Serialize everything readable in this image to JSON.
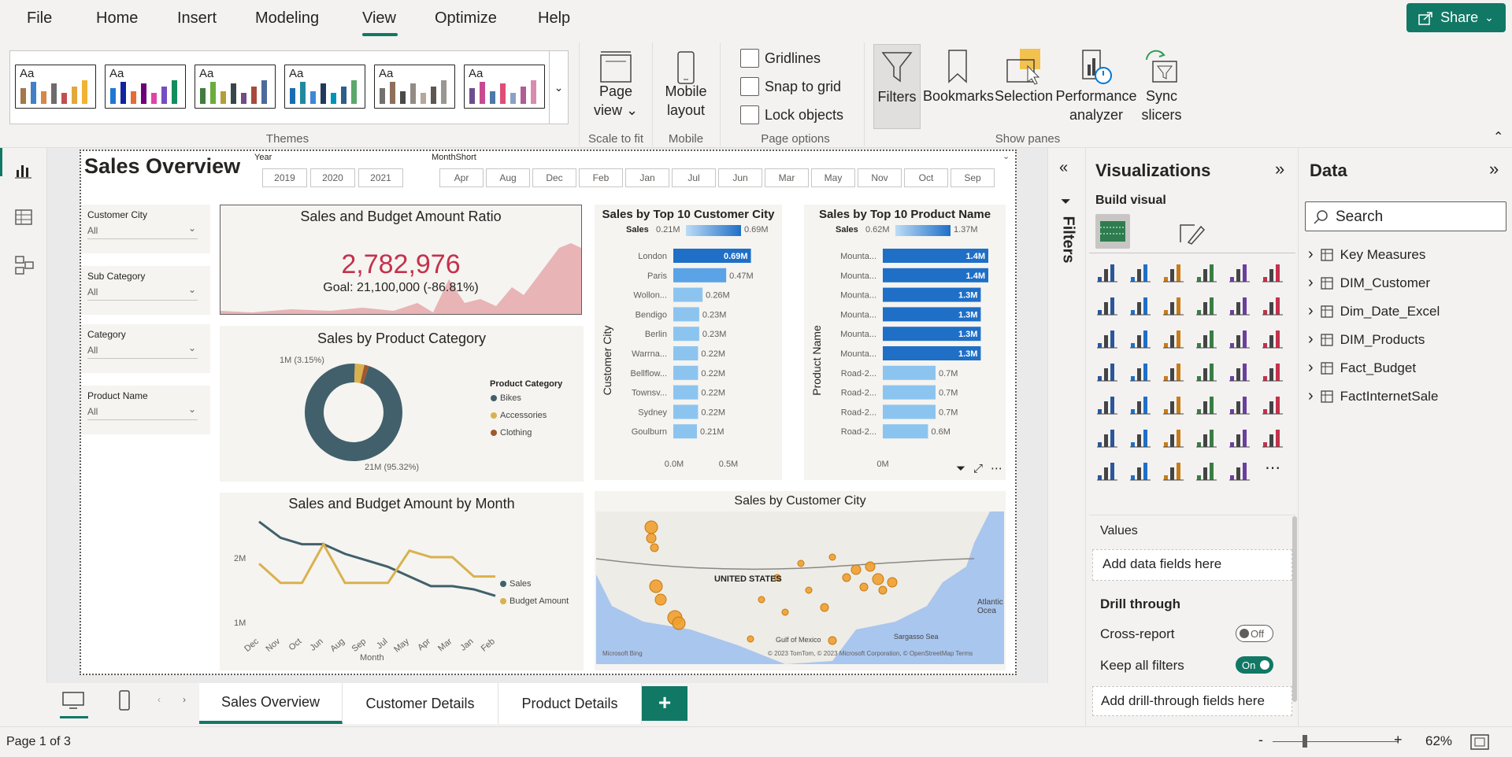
{
  "menu": {
    "file": "File",
    "home": "Home",
    "insert": "Insert",
    "modeling": "Modeling",
    "view": "View",
    "optimize": "Optimize",
    "help": "Help",
    "share": "Share"
  },
  "ribbon": {
    "themes_label": "Themes",
    "theme_aa": "Aa",
    "page_view": "Page view",
    "scale_to_fit": "Scale to fit",
    "mobile_layout": "Mobile layout",
    "mobile_label": "Mobile",
    "gridlines": "Gridlines",
    "snap_to_grid": "Snap to grid",
    "lock_objects": "Lock objects",
    "page_options": "Page options",
    "filters": "Filters",
    "bookmarks": "Bookmarks",
    "selection": "Selection",
    "performance_analyzer": "Performance analyzer",
    "sync_slicers": "Sync slicers",
    "show_panes": "Show panes"
  },
  "report": {
    "title": "Sales Overview",
    "year_label": "Year",
    "years": [
      "2019",
      "2020",
      "2021"
    ],
    "month_label": "MonthShort",
    "months": [
      "Apr",
      "Aug",
      "Dec",
      "Feb",
      "Jan",
      "Jul",
      "Jun",
      "Mar",
      "May",
      "Nov",
      "Oct",
      "Sep"
    ],
    "slicers": [
      {
        "label": "Customer City",
        "value": "All"
      },
      {
        "label": "Sub Category",
        "value": "All"
      },
      {
        "label": "Category",
        "value": "All"
      },
      {
        "label": "Product Name",
        "value": "All"
      }
    ],
    "kpi": {
      "title": "Sales and Budget Amount Ratio",
      "value": "2,782,976",
      "goal": "Goal: 21,100,000 (-86.81%)"
    },
    "donut": {
      "title": "Sales by Product Category",
      "legend_title": "Product Category",
      "label_small": "1M (3.15%)",
      "label_big": "21M (95.32%)"
    },
    "line": {
      "title": "Sales and Budget Amount by Month",
      "xlabel": "Month",
      "y_top": "2M",
      "y_bottom": "1M"
    },
    "map": {
      "title": "Sales by Customer City",
      "country": "UNITED STATES",
      "credit": "© 2023 TomTom, © 2023 Microsoft Corporation, © OpenStreetMap  Terms",
      "bing": "Microsoft Bing",
      "gulf": "Gulf of Mexico",
      "sargasso": "Sargasso Sea",
      "atlantic": "Atlantic Ocea"
    },
    "city_chart": {
      "title": "Sales by Top 10 Customer City",
      "ylabel": "Customer City",
      "legend_label": "Sales",
      "legend_min": "0.21M",
      "legend_max": "0.69M"
    },
    "product_chart": {
      "title": "Sales by Top 10 Product Name",
      "ylabel": "Product Name",
      "legend_label": "Sales",
      "legend_min": "0.62M",
      "legend_max": "1.37M"
    }
  },
  "chart_data": [
    {
      "type": "bar",
      "title": "Sales by Top 10 Customer City",
      "categories": [
        "London",
        "Paris",
        "Wollon...",
        "Bendigo",
        "Berlin",
        "Warrna...",
        "Bellflow...",
        "Townsv...",
        "Sydney",
        "Goulburn"
      ],
      "values": [
        0.69,
        0.47,
        0.26,
        0.23,
        0.23,
        0.22,
        0.22,
        0.22,
        0.22,
        0.21
      ],
      "labels": [
        "0.69M",
        "0.47M",
        "0.26M",
        "0.23M",
        "0.23M",
        "0.22M",
        "0.22M",
        "0.22M",
        "0.22M",
        "0.21M"
      ],
      "xticks": [
        "0.0M",
        "0.5M"
      ],
      "xlim": [
        0,
        0.7
      ],
      "ylabel": "Customer City"
    },
    {
      "type": "bar",
      "title": "Sales by Top 10 Product Name",
      "categories": [
        "Mounta...",
        "Mounta...",
        "Mounta...",
        "Mounta...",
        "Mounta...",
        "Mounta...",
        "Road-2...",
        "Road-2...",
        "Road-2...",
        "Road-2..."
      ],
      "values": [
        1.4,
        1.4,
        1.3,
        1.3,
        1.3,
        1.3,
        0.7,
        0.7,
        0.7,
        0.6
      ],
      "labels": [
        "1.4M",
        "1.4M",
        "1.3M",
        "1.3M",
        "1.3M",
        "1.3M",
        "0.7M",
        "0.7M",
        "0.7M",
        "0.6M"
      ],
      "xticks": [
        "0M"
      ],
      "xlim": [
        0,
        1.4
      ],
      "ylabel": "Product Name"
    },
    {
      "type": "pie",
      "title": "Sales by Product Category",
      "categories": [
        "Bikes",
        "Accessories",
        "Clothing"
      ],
      "values": [
        95.32,
        3.15,
        1.53
      ],
      "colors": [
        "#41606b",
        "#d9b14f",
        "#a0582f"
      ]
    },
    {
      "type": "line",
      "title": "Sales and Budget Amount by Month",
      "categories": [
        "Dec",
        "Nov",
        "Oct",
        "Jun",
        "Aug",
        "Sep",
        "Jul",
        "May",
        "Apr",
        "Mar",
        "Jan",
        "Feb"
      ],
      "series": [
        {
          "name": "Sales",
          "values": [
            2.55,
            2.3,
            2.2,
            2.2,
            2.05,
            1.95,
            1.85,
            1.7,
            1.55,
            1.55,
            1.5,
            1.4
          ],
          "color": "#41606b"
        },
        {
          "name": "Budget Amount",
          "values": [
            1.9,
            1.6,
            1.6,
            2.2,
            1.6,
            1.6,
            1.6,
            2.1,
            2.0,
            2.0,
            1.7,
            1.7
          ],
          "color": "#d9b14f"
        }
      ],
      "xlabel": "Month",
      "yticks": [
        "1M",
        "2M"
      ]
    }
  ],
  "viz_pane": {
    "title": "Visualizations",
    "build_visual": "Build visual",
    "values": "Values",
    "add_data": "Add data fields here",
    "drill_through": "Drill through",
    "cross_report": "Cross-report",
    "cross_state": "Off",
    "keep_filters": "Keep all filters",
    "keep_state": "On",
    "add_drill": "Add drill-through fields here"
  },
  "filters_pane": {
    "title": "Filters"
  },
  "data_pane": {
    "title": "Data",
    "search_placeholder": "Search",
    "items": [
      "Key Measures",
      "DIM_Customer",
      "Dim_Date_Excel",
      "DIM_Products",
      "Fact_Budget",
      "FactInternetSale"
    ]
  },
  "tabs": [
    "Sales Overview",
    "Customer Details",
    "Product Details"
  ],
  "status": {
    "page": "Page 1 of 3",
    "zoom": "62%"
  },
  "colors": {
    "accent": "#117865",
    "bar_dark": "#1f6fc7",
    "bar_light": "#8cc4f0",
    "kpi_red": "#c4314b"
  }
}
